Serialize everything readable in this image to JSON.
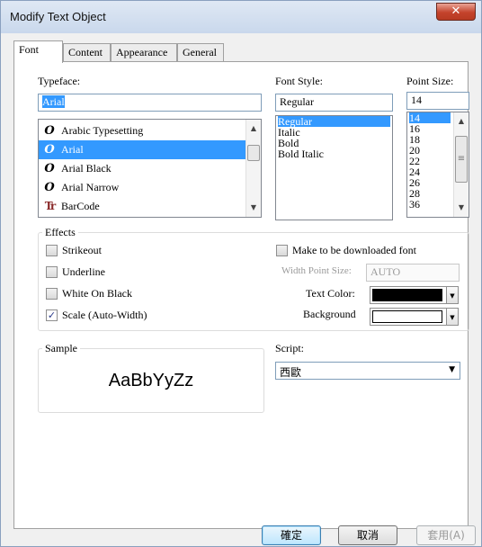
{
  "window": {
    "title": "Modify Text Object",
    "close_glyph": "✕"
  },
  "tabs": [
    {
      "label": "Font",
      "active": true
    },
    {
      "label": "Content",
      "active": false
    },
    {
      "label": "Appearance",
      "active": false
    },
    {
      "label": "General",
      "active": false
    }
  ],
  "typeface": {
    "label": "Typeface:",
    "value": "Arial",
    "items": [
      {
        "name": "Arabic Typesetting",
        "icon": "opentype-icon",
        "glyph": "O",
        "selected": false
      },
      {
        "name": "Arial",
        "icon": "opentype-icon",
        "glyph": "O",
        "selected": true
      },
      {
        "name": "Arial Black",
        "icon": "opentype-icon",
        "glyph": "O",
        "selected": false
      },
      {
        "name": "Arial Narrow",
        "icon": "opentype-icon",
        "glyph": "O",
        "selected": false
      },
      {
        "name": "BarCode",
        "icon": "truetype-icon",
        "glyph": "Tr",
        "selected": false
      }
    ]
  },
  "font_style": {
    "label": "Font Style:",
    "value": "Regular",
    "items": [
      "Regular",
      "Italic",
      "Bold",
      "Bold Italic"
    ],
    "selected_index": 0
  },
  "point_size": {
    "label": "Point Size:",
    "value": "14",
    "items": [
      "14",
      "16",
      "18",
      "20",
      "22",
      "24",
      "26",
      "28",
      "36"
    ],
    "selected_index": 0
  },
  "effects": {
    "title": "Effects",
    "strikeout": {
      "label": "Strikeout",
      "checked": false
    },
    "underline": {
      "label": "Underline",
      "checked": false
    },
    "white_on_black": {
      "label": "White On Black",
      "checked": false
    },
    "scale": {
      "label": "Scale (Auto-Width)",
      "checked": true
    },
    "download_font": {
      "label": "Make to be downloaded font",
      "checked": false
    },
    "width_point_size": {
      "label": "Width Point Size:",
      "value": "AUTO"
    },
    "text_color": {
      "label": "Text Color:",
      "color": "#000000"
    },
    "background": {
      "label": "Background",
      "color": "#ffffff"
    }
  },
  "sample": {
    "title": "Sample",
    "text": "AaBbYyZz"
  },
  "script": {
    "label": "Script:",
    "value": "西歐"
  },
  "buttons": {
    "ok": "確定",
    "cancel": "取消",
    "apply": "套用(A)"
  },
  "icons": {
    "check": "✓",
    "dropdown": "▼",
    "scroll_up": "▲",
    "scroll_down": "▼",
    "grip": "≡"
  }
}
